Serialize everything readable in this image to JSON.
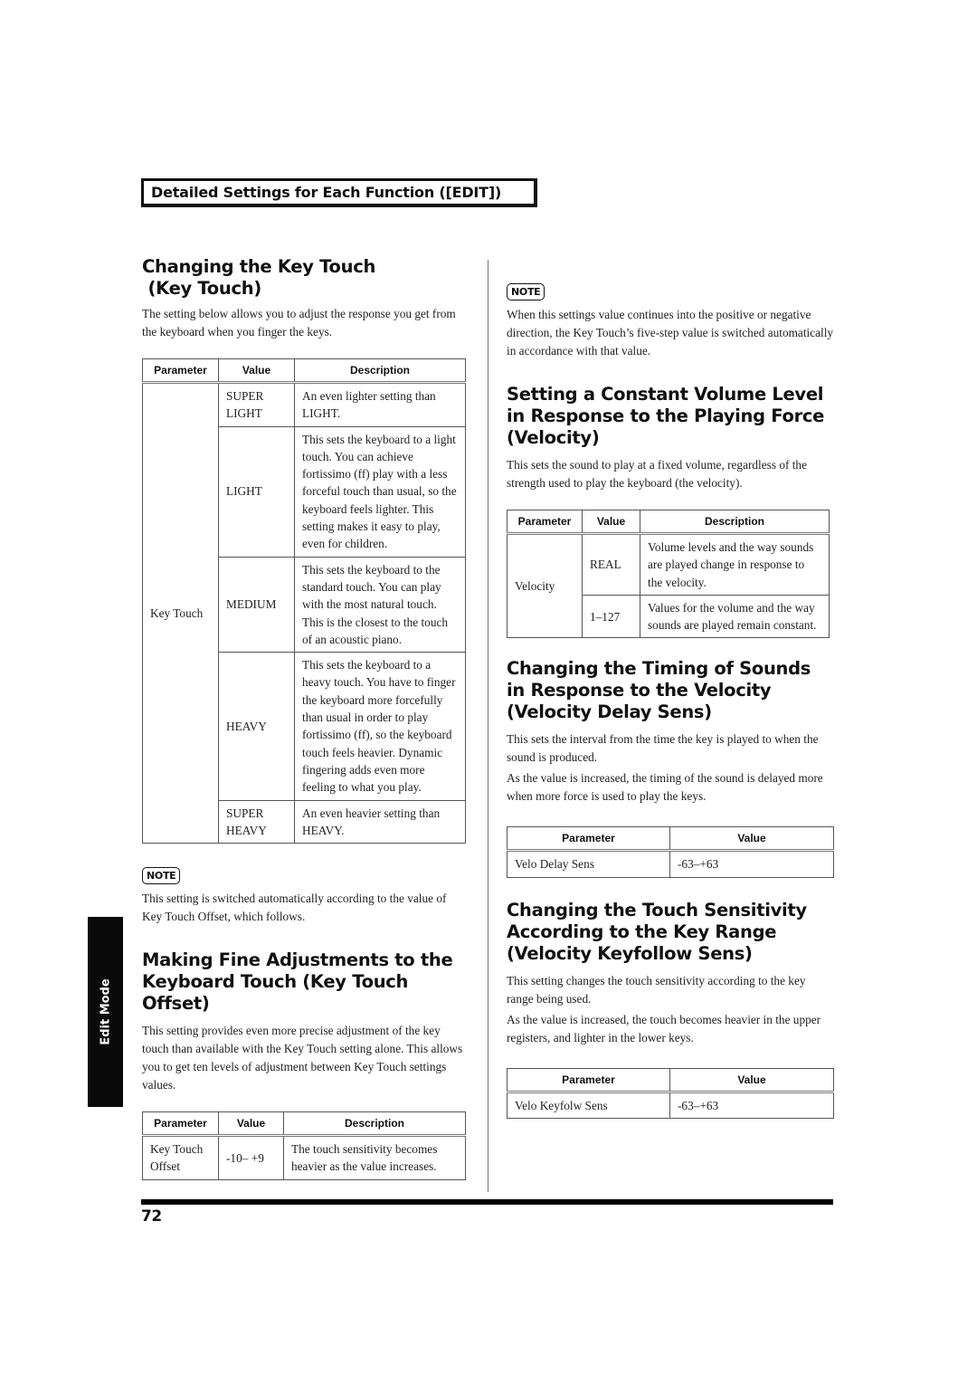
{
  "header": {
    "section_title": "Detailed Settings for Each Function ([EDIT])"
  },
  "side_tab": {
    "label": "Edit Mode"
  },
  "footer": {
    "page_number": "72"
  },
  "note_label": "NOTE",
  "left": {
    "key_touch": {
      "title_line1": "Changing the Key Touch",
      "title_line2": " (Key Touch)",
      "intro": "The setting below allows you to adjust the response you get from the keyboard when you finger the keys.",
      "table": {
        "headers": [
          "Parameter",
          "Value",
          "Description"
        ],
        "parameter": "Key Touch",
        "rows": [
          {
            "value": "SUPER LIGHT",
            "description": "An even lighter setting than LIGHT."
          },
          {
            "value": "LIGHT",
            "description": "This sets the keyboard to a light touch. You can achieve fortissimo (ff) play with a less forceful touch than usual, so the keyboard feels lighter. This setting makes it easy to play, even for children."
          },
          {
            "value": "MEDIUM",
            "description": "This sets the keyboard to the standard touch. You can play with the most natural touch. This is the closest to the touch of an acoustic piano."
          },
          {
            "value": "HEAVY",
            "description": "This sets the keyboard to a heavy touch. You have to finger the keyboard more forcefully than usual in order to play fortissimo (ff), so the keyboard touch feels heavier. Dynamic fingering adds even more feeling to what you play."
          },
          {
            "value": "SUPER HEAVY",
            "description": "An even heavier setting than HEAVY."
          }
        ]
      },
      "note": "This setting is switched automatically according to the value of Key Touch Offset, which follows."
    },
    "key_touch_offset": {
      "title_line1": "Making Fine Adjustments to the",
      "title_line2": "Keyboard Touch (Key Touch Offset)",
      "intro": "This setting provides even more precise adjustment of the key touch than available with the Key Touch setting alone. This allows you to get ten levels of adjustment between Key Touch settings values.",
      "table": {
        "headers": [
          "Parameter",
          "Value",
          "Description"
        ],
        "rows": [
          {
            "parameter": "Key Touch Offset",
            "value": "-10– +9",
            "description": "The touch sensitivity becomes heavier as the value increases."
          }
        ]
      }
    }
  },
  "right": {
    "note": "When this settings value continues into the positive or negative direction, the Key Touch’s five-step value is switched automatically in accordance with that value.",
    "velocity": {
      "title_line1": "Setting a Constant Volume Level",
      "title_line2": "in Response to the Playing Force",
      "title_line3": "(Velocity)",
      "intro": "This sets the sound to play at a fixed volume, regardless of the strength used to play the keyboard (the velocity).",
      "table": {
        "headers": [
          "Parameter",
          "Value",
          "Description"
        ],
        "parameter": "Velocity",
        "rows": [
          {
            "value": "REAL",
            "description": "Volume levels and the way sounds are played change in response to the velocity."
          },
          {
            "value": "1–127",
            "description": "Values for the volume and the way sounds are played remain constant."
          }
        ]
      }
    },
    "velocity_delay": {
      "title_line1": "Changing the Timing of Sounds",
      "title_line2": "in Response to the Velocity",
      "title_line3": "(Velocity Delay Sens)",
      "para1": "This sets the interval from the time the key is played to when the sound is produced.",
      "para2": "As the value is increased, the timing of the sound is delayed more when more force is used to play the keys.",
      "table": {
        "headers": [
          "Parameter",
          "Value"
        ],
        "rows": [
          {
            "parameter": "Velo Delay Sens",
            "value": "-63–+63"
          }
        ]
      }
    },
    "velocity_keyfollow": {
      "title_line1": "Changing the Touch Sensitivity",
      "title_line2": "According to the Key Range",
      "title_line3": "(Velocity Keyfollow Sens)",
      "para1": "This setting changes the touch sensitivity according to the key range being used.",
      "para2": "As the value is increased, the touch becomes heavier in the upper registers, and lighter in the lower keys.",
      "table": {
        "headers": [
          "Parameter",
          "Value"
        ],
        "rows": [
          {
            "parameter": "Velo Keyfolw Sens",
            "value": "-63–+63"
          }
        ]
      }
    }
  }
}
